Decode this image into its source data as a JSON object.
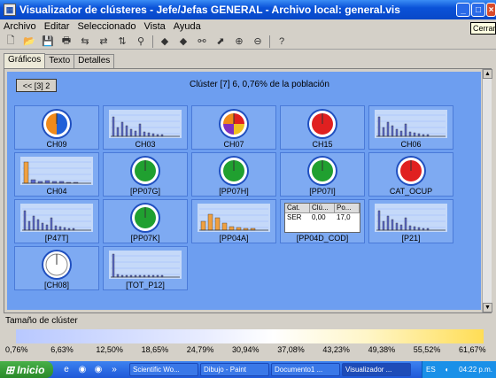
{
  "window": {
    "title": "Visualizador de clústeres - Jefe/Jefas GENERAL - Archivo local: general.vis"
  },
  "menu": [
    "Archivo",
    "Editar",
    "Seleccionado",
    "Vista",
    "Ayuda"
  ],
  "tooltip": "Cerrar",
  "tabs": [
    "Gráficos",
    "Texto",
    "Detalles"
  ],
  "nav": {
    "label": "<< [3] 2"
  },
  "cluster_header": "Clúster [7] 6, 0,76% de la población",
  "cells": [
    {
      "label": "CH09",
      "kind": "donut",
      "colors": [
        "#f08a1a",
        "#2060d8"
      ]
    },
    {
      "label": "CH03",
      "kind": "bars"
    },
    {
      "label": "CH07",
      "kind": "donut4"
    },
    {
      "label": "CH15",
      "kind": "donut",
      "colors": [
        "#e02020",
        "#e02020"
      ]
    },
    {
      "label": "CH06",
      "kind": "bars"
    },
    {
      "label": "CH04",
      "kind": "bars2"
    },
    {
      "label": "[PP07G]",
      "kind": "donut",
      "colors": [
        "#20a030",
        "#20a030"
      ]
    },
    {
      "label": "[PP07H]",
      "kind": "donut",
      "colors": [
        "#20a030",
        "#20a030"
      ]
    },
    {
      "label": "[PP07I]",
      "kind": "donut",
      "colors": [
        "#20a030",
        "#20a030"
      ]
    },
    {
      "label": "CAT_OCUP",
      "kind": "donut",
      "colors": [
        "#e02020",
        "#e02020"
      ]
    },
    {
      "label": "[P47T]",
      "kind": "bars"
    },
    {
      "label": "[PP07K]",
      "kind": "donut",
      "colors": [
        "#20a030",
        "#20a030"
      ]
    },
    {
      "label": "[PP04A]",
      "kind": "bars3"
    },
    {
      "label": "[PP04D_COD]",
      "kind": "table"
    },
    {
      "label": "[P21]",
      "kind": "bars"
    },
    {
      "label": "[CH08]",
      "kind": "donut",
      "colors": [
        "#ffffff",
        "#ffffff"
      ]
    },
    {
      "label": "[TOT_P12]",
      "kind": "bars4"
    }
  ],
  "mini_table": {
    "headers": [
      "Cat.",
      "Clú...",
      "Po..."
    ],
    "row": [
      "SER",
      "0,00",
      "17,0"
    ]
  },
  "sizebar": {
    "title": "Tamaño de clúster",
    "ticks": [
      "0,76%",
      "6,63%",
      "12,50%",
      "18,65%",
      "24,79%",
      "30,94%",
      "37,08%",
      "43,23%",
      "49,38%",
      "55,52%",
      "61,67%"
    ]
  },
  "taskbar": {
    "start": "Inicio",
    "tasks": [
      "Scientific Wo...",
      "Dibujo - Paint",
      "Documento1 ...",
      "Visualizador ..."
    ],
    "lang": "ES",
    "time": "04:22 p.m."
  }
}
